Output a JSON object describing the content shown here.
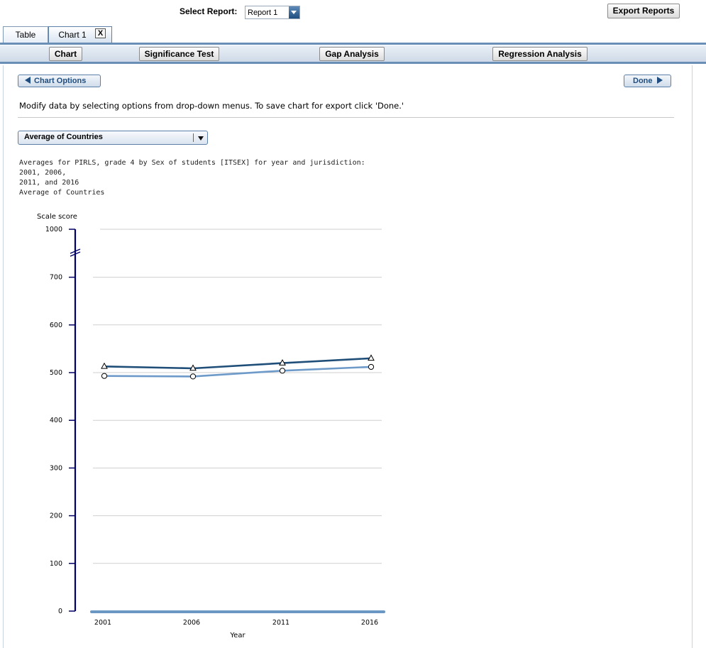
{
  "header": {
    "select_report_label": "Select Report:",
    "select_report_value": "Report 1",
    "export_label": "Export Reports"
  },
  "tabs": [
    {
      "label": "Table"
    },
    {
      "label": "Chart 1",
      "close_label": "X"
    }
  ],
  "subnav": {
    "chart": "Chart",
    "significance": "Significance Test",
    "gap": "Gap Analysis",
    "regression": "Regression Analysis"
  },
  "panel": {
    "chart_options": "Chart Options",
    "done": "Done",
    "instructions": "Modify data by selecting options from drop-down menus. To save chart for export click 'Done.'",
    "jurisdiction_select": "Average of Countries",
    "description_line1": "Averages for PIRLS, grade 4 by Sex of students [ITSEX] for year and jurisdiction: 2001, 2006,",
    "description_line2": "2011, and 2016",
    "description_line3": "Average of Countries"
  },
  "colors": {
    "dark_series": "#1f4e79",
    "light_series": "#6d9ac9",
    "axis": "#000066"
  },
  "chart_data": {
    "type": "line",
    "ylabel": "Scale score",
    "xlabel": "Year",
    "categories": [
      "2001",
      "2006",
      "2011",
      "2016"
    ],
    "yticks": [
      0,
      100,
      200,
      300,
      400,
      500,
      600,
      700,
      1000
    ],
    "axis_break": "between 700 and 1000",
    "ylim": [
      0,
      1000
    ],
    "grid": true,
    "series": [
      {
        "marker": "triangle",
        "color": "#1f4e79",
        "values": [
          513,
          509,
          520,
          530
        ]
      },
      {
        "marker": "circle",
        "color": "#6d9ac9",
        "values": [
          493,
          492,
          504,
          512
        ]
      }
    ]
  }
}
